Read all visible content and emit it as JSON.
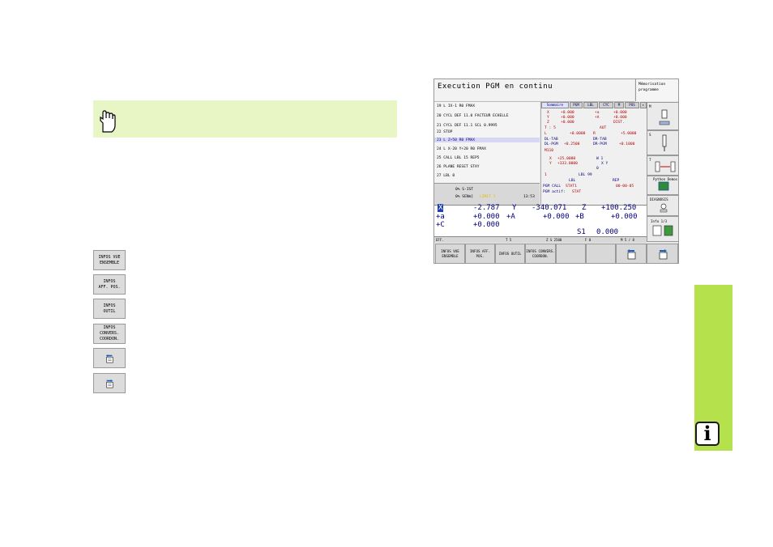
{
  "note_icon": "hand-pointing-icon",
  "softkeys": [
    {
      "lines": [
        "INFOS VUE",
        "ENSEMBLE"
      ]
    },
    {
      "lines": [
        "INFOS",
        "AFF. POS."
      ]
    },
    {
      "lines": [
        "INFOS",
        "OUTIL"
      ]
    },
    {
      "lines": [
        "INFOS",
        "CONVERS.",
        "COORDON."
      ]
    },
    {
      "icon": "page-back-icon"
    },
    {
      "icon": "page-forward-icon"
    }
  ],
  "side_tab": {
    "color": "#b5e24c",
    "icon": "info-icon",
    "label": "i"
  },
  "screen": {
    "title": "Execution PGM en continu",
    "mode_label_1": "Mémorisation",
    "mode_label_2": "programme",
    "program_lines": [
      "19 L IX-1 R0 FMAX",
      "20 CYCL DEF 11.0 FACTEUR ECHELLE",
      "21 CYCL DEF 11.1 SCL 0.9995",
      "22 STOP",
      "23 L  Z+50 R0 FMAX",
      "24 L  X-20  Y+20 R0 FMAX",
      "25 CALL LBL 15 REP5",
      "26 PLANE RESET STAY",
      "27 LBL 0"
    ],
    "clock_lines": [
      "0% S-IST",
      "0% SENm]",
      "LIMIT 1",
      "13:53"
    ],
    "tabs": [
      "Sommaire",
      "PGM",
      "LBL",
      "CYC",
      "M",
      "POS"
    ],
    "status_rows": [
      [
        "X",
        "+0.000",
        "+a",
        "+0.000"
      ],
      [
        "Y",
        "+0.000",
        "+A",
        "+0.000"
      ],
      [
        "Z",
        "+0.000",
        "",
        "DIST."
      ],
      [
        "T : 5",
        "",
        "AUT",
        ""
      ],
      [
        "L",
        "+0.0000",
        "R",
        "+5.0000"
      ],
      [
        "DL-TAB",
        "",
        "DR-TAB",
        ""
      ],
      [
        "DL-PGM",
        "+0.2500",
        "DR-PGM",
        "+0.1000"
      ],
      [
        "M110",
        "",
        "",
        ""
      ],
      [
        "X",
        "+25.0000",
        "W 1",
        ""
      ],
      [
        "Y",
        "+333.0000",
        "X Y",
        ""
      ],
      [
        "",
        "",
        "0",
        ""
      ],
      [
        "1",
        "LBL 99",
        "",
        ""
      ],
      [
        "",
        "LBL",
        "REP",
        ""
      ],
      [
        "PGM CALL",
        "STAT1",
        "00-00-05",
        ""
      ],
      [
        "PGM actif:",
        "STAT",
        "",
        ""
      ]
    ],
    "vkeys": [
      {
        "label": "M",
        "icon": "machine-icon"
      },
      {
        "label": "S",
        "icon": "spindle-icon"
      },
      {
        "label": "T",
        "icon": "tool-icon"
      },
      {
        "label": "Python Demos",
        "icon": "python-icon"
      },
      {
        "label": "DIAGNOSIS",
        "icon": "diagnosis-icon"
      },
      {
        "label": "Info 1/3",
        "icon": "info-icon"
      }
    ],
    "positions": [
      [
        "X",
        "-2.787",
        "Y",
        "-340.071",
        "Z",
        "+100.250"
      ],
      [
        "+a",
        "+0.000",
        "+A",
        "+0.000",
        "+B",
        "+0.000"
      ],
      [
        "+C",
        "+0.000",
        "",
        "",
        "",
        ""
      ],
      [
        "",
        "",
        "",
        "",
        "S1",
        "0.000"
      ]
    ],
    "status_bar": [
      "EFF.",
      "T 5",
      "Z S 2500",
      "F 0",
      "M 5 / 8"
    ],
    "softkey_bar": [
      "INFOS VUE ENSEMBLE",
      "INFOS AFF. POS.",
      "INFOS OUTIL",
      "INFOS CONVERS. COORDON.",
      "",
      "",
      "",
      ""
    ]
  }
}
